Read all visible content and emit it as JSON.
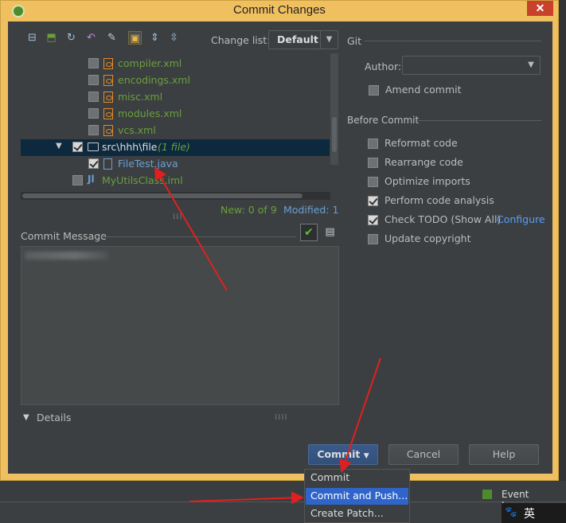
{
  "window": {
    "title": "Commit Changes",
    "close_glyph": "✕",
    "accent": "#f0c060"
  },
  "toolbar": {
    "change_list_label": "Change list:",
    "change_list_value": "Default"
  },
  "tree": {
    "rows": [
      {
        "name": "compiler.xml"
      },
      {
        "name": "encodings.xml"
      },
      {
        "name": "misc.xml"
      },
      {
        "name": "modules.xml"
      },
      {
        "name": "vcs.xml"
      }
    ],
    "folder": {
      "name": "src\\hhh\\file",
      "count": "(1 file)"
    },
    "java_file": "FileTest.java",
    "other_file": "MyUtilsClass.iml",
    "summary_new": "New: 0 of 9",
    "summary_modified": "Modified: 1"
  },
  "commit_message": {
    "label": "Commit Message"
  },
  "details": {
    "label": "Details"
  },
  "git": {
    "section": "Git",
    "author_label": "Author:",
    "author_value": "",
    "amend_label": "Amend commit"
  },
  "before_commit": {
    "section": "Before Commit",
    "options": [
      {
        "label": "Reformat code",
        "checked": false
      },
      {
        "label": "Rearrange code",
        "checked": false
      },
      {
        "label": "Optimize imports",
        "checked": false
      },
      {
        "label": "Perform code analysis",
        "checked": true
      },
      {
        "label": "Check TODO (Show All)",
        "checked": true
      },
      {
        "label": "Update copyright",
        "checked": false
      }
    ],
    "configure_link": "Configure"
  },
  "buttons": {
    "commit": "Commit",
    "cancel": "Cancel",
    "help": "Help"
  },
  "menu": {
    "items": [
      "Commit",
      "Commit and Push...",
      "Create Patch..."
    ]
  },
  "statusbar": {
    "event_log": "Event Log",
    "ime": "英"
  }
}
